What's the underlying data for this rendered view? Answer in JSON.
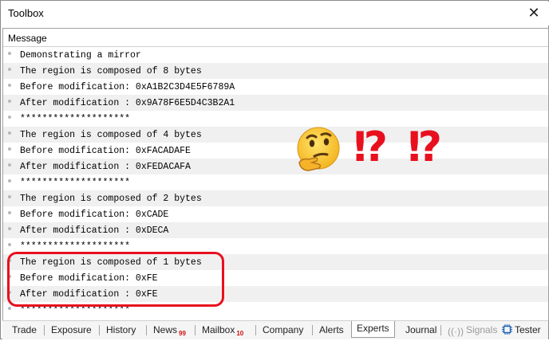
{
  "window": {
    "title": "Toolbox"
  },
  "panel": {
    "column_header": "Message"
  },
  "messages": [
    "Demonstrating a mirror",
    "The region is composed of 8 bytes",
    "Before modification: 0xA1B2C3D4E5F6789A",
    "After modification : 0x9A78F6E5D4C3B2A1",
    "********************",
    "The region is composed of 4 bytes",
    "Before modification: 0xFACADAFE",
    "After modification : 0xFEDACAFA",
    "********************",
    "The region is composed of 2 bytes",
    "Before modification: 0xCADE",
    "After modification : 0xDECA",
    "********************",
    "The region is composed of 1 bytes",
    "Before modification: 0xFE",
    "After modification : 0xFE",
    "********************"
  ],
  "overlay": {
    "emoji": "thinking-face",
    "punct1": "⁉",
    "punct2": "⁉",
    "accent": "#e8101e"
  },
  "tabs": [
    {
      "label": "Trade"
    },
    {
      "label": "Exposure"
    },
    {
      "label": "History"
    },
    {
      "label": "News",
      "badge": "99"
    },
    {
      "label": "Mailbox",
      "badge": "10"
    },
    {
      "label": "Company"
    },
    {
      "label": "Alerts"
    },
    {
      "label": "Experts",
      "active": true
    },
    {
      "label": "Journal"
    },
    {
      "label": "Signals",
      "disabled": true,
      "icon": "signal-icon"
    },
    {
      "label": "Tester",
      "icon": "chip-icon"
    }
  ]
}
